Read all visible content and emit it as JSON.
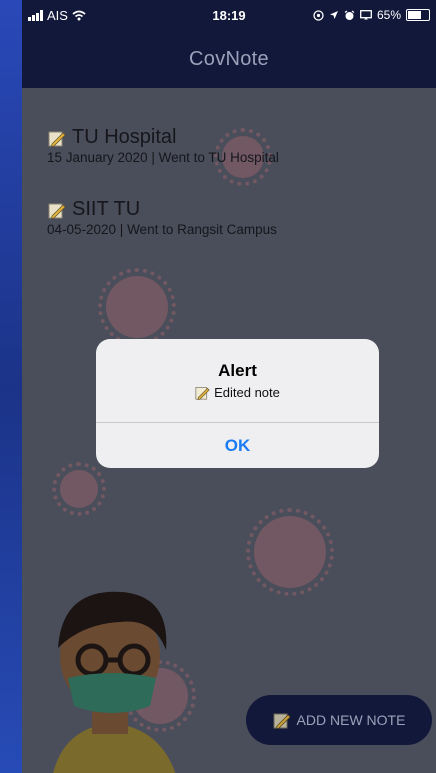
{
  "status_bar": {
    "carrier": "AIS",
    "time": "18:19",
    "battery": "65%"
  },
  "app": {
    "title": "CovNote"
  },
  "notes": [
    {
      "title": "TU Hospital",
      "subtitle": "15 January 2020 | Went to TU Hospital"
    },
    {
      "title": "SIIT TU",
      "subtitle": "04-05-2020 | Went to Rangsit Campus"
    }
  ],
  "fab": {
    "label": "ADD NEW NOTE"
  },
  "alert": {
    "title": "Alert",
    "message": "Edited note",
    "ok_label": "OK"
  },
  "icons": {
    "note": "memo-pencil-icon",
    "wifi": "wifi-icon",
    "battery": "battery-icon"
  },
  "colors": {
    "accent": "#1a7cf5",
    "navbar": "#12183a",
    "overlay_bg": "#4a4e5a"
  }
}
